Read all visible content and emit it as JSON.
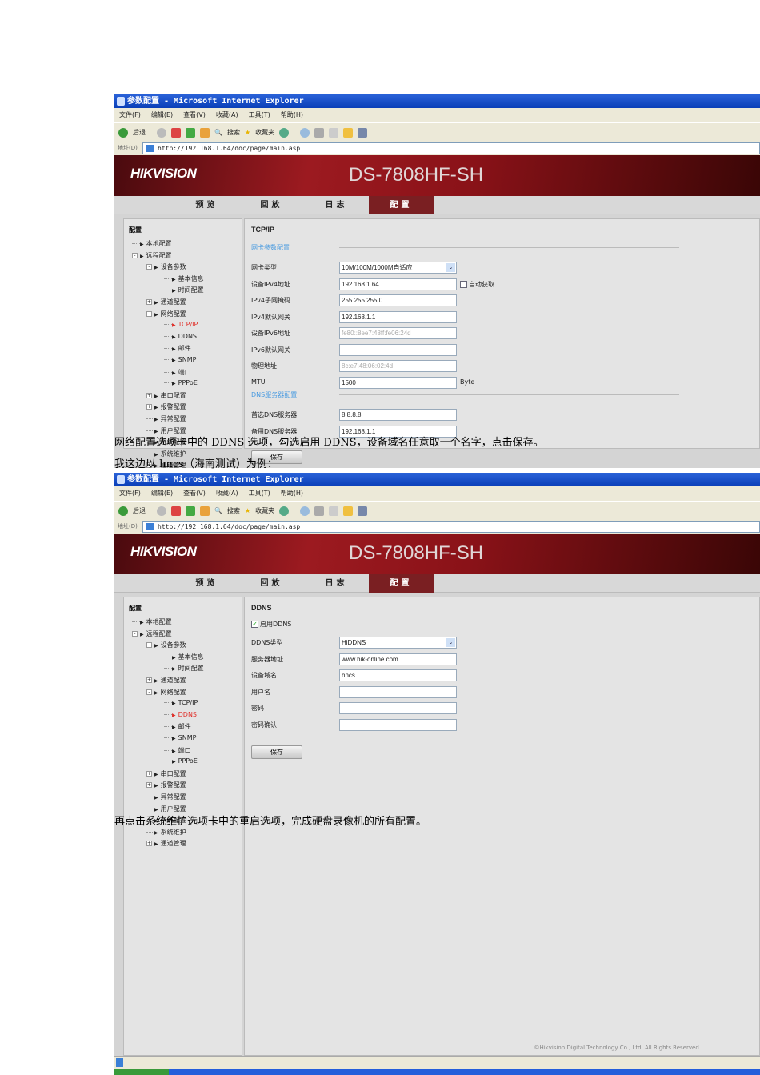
{
  "paragraphs": [
    "网络配置选项卡中的 DDNS 选项，勾选启用 DDNS，设备域名任意取一个名字，点击保存。",
    "我这边以 hncs（海南测试）为例：",
    "再点击系统维护选项卡中的重启选项，完成硬盘录像机的所有配置。"
  ],
  "browser": {
    "title": "参数配置 - Microsoft Internet Explorer",
    "menu": [
      "文件(F)",
      "编辑(E)",
      "查看(V)",
      "收藏(A)",
      "工具(T)",
      "帮助(H)"
    ],
    "toolbar": {
      "back": "后退",
      "search": "搜索",
      "favorites": "收藏夹"
    },
    "address_label": "地址(D)",
    "url": "http://192.168.1.64/doc/page/main.asp"
  },
  "app": {
    "logo": "HIKVISION",
    "model": "DS-7808HF-SH",
    "tabs": [
      "预览",
      "回放",
      "日志",
      "配置"
    ],
    "active_tab": 3,
    "tree_header": "配置",
    "tree": [
      {
        "label": "本地配置",
        "level": 1,
        "toggle": ""
      },
      {
        "label": "远程配置",
        "level": 1,
        "toggle": "-"
      },
      {
        "label": "设备参数",
        "level": 2,
        "toggle": "-"
      },
      {
        "label": "基本信息",
        "level": 3,
        "toggle": ""
      },
      {
        "label": "时间配置",
        "level": 3,
        "toggle": ""
      },
      {
        "label": "通道配置",
        "level": 2,
        "toggle": "+"
      },
      {
        "label": "网络配置",
        "level": 2,
        "toggle": "-"
      },
      {
        "label": "TCP/IP",
        "level": 3,
        "toggle": ""
      },
      {
        "label": "DDNS",
        "level": 3,
        "toggle": ""
      },
      {
        "label": "邮件",
        "level": 3,
        "toggle": ""
      },
      {
        "label": "SNMP",
        "level": 3,
        "toggle": ""
      },
      {
        "label": "端口",
        "level": 3,
        "toggle": ""
      },
      {
        "label": "PPPoE",
        "level": 3,
        "toggle": ""
      },
      {
        "label": "串口配置",
        "level": 2,
        "toggle": "+"
      },
      {
        "label": "报警配置",
        "level": 2,
        "toggle": "+"
      },
      {
        "label": "异常配置",
        "level": 2,
        "toggle": ""
      },
      {
        "label": "用户配置",
        "level": 2,
        "toggle": ""
      },
      {
        "label": "系统配置",
        "level": 2,
        "toggle": ""
      },
      {
        "label": "系统维护",
        "level": 2,
        "toggle": ""
      },
      {
        "label": "通道管理",
        "level": 2,
        "toggle": "+"
      }
    ],
    "copyright": "©Hikvision Digital Technology Co., Ltd. All Rights Reserved."
  },
  "screens": [
    {
      "selected_tree": 7,
      "title": "TCP/IP",
      "sections": [
        {
          "title": "网卡参数配置",
          "fields": [
            {
              "label": "网卡类型",
              "value": "10M/100M/1000M自适应",
              "type": "select"
            },
            {
              "label": "设备IPv4地址",
              "value": "192.168.1.64",
              "aux": "自动获取",
              "aux_type": "checkbox"
            },
            {
              "label": "IPv4子网掩码",
              "value": "255.255.255.0"
            },
            {
              "label": "IPv4默认网关",
              "value": "192.168.1.1"
            },
            {
              "label": "设备IPv6地址",
              "value": "fe80::8ee7:48ff:fe06:24d",
              "disabled": true
            },
            {
              "label": "IPv6默认网关",
              "value": ""
            },
            {
              "label": "物理地址",
              "value": "8c:e7:48:06:02:4d",
              "disabled": true
            },
            {
              "label": "MTU",
              "value": "1500",
              "aux": "Byte"
            }
          ]
        },
        {
          "title": "DNS服务器配置",
          "fields": [
            {
              "label": "首选DNS服务器",
              "value": "8.8.8.8"
            },
            {
              "label": "备用DNS服务器",
              "value": "192.168.1.1"
            }
          ]
        }
      ],
      "save": "保存"
    },
    {
      "selected_tree": 8,
      "title": "DDNS",
      "enable_label": "启用DDNS",
      "enable_checked": true,
      "fields": [
        {
          "label": "DDNS类型",
          "value": "HiDDNS",
          "type": "select"
        },
        {
          "label": "服务器地址",
          "value": "www.hik-online.com"
        },
        {
          "label": "设备域名",
          "value": "hncs"
        },
        {
          "label": "用户名",
          "value": ""
        },
        {
          "label": "密码",
          "value": ""
        },
        {
          "label": "密码确认",
          "value": ""
        }
      ],
      "save": "保存"
    }
  ]
}
